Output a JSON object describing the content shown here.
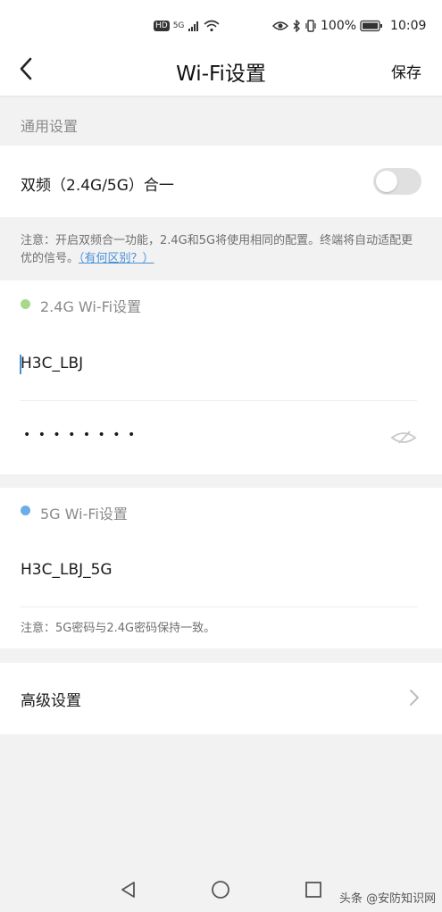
{
  "status_bar": {
    "hd": "HD",
    "net": "5G",
    "battery": "100%",
    "time": "10:09"
  },
  "header": {
    "title": "Wi-Fi设置",
    "save_label": "保存"
  },
  "general": {
    "section_label": "通用设置",
    "dual_band_label": "双频（2.4G/5G）合一",
    "dual_band_enabled": false,
    "note_prefix": "注意：开启双频合一功能，2.4G和5G将使用相同的配置。终端将自动适配更优的信号。",
    "note_link": "（有何区别？）"
  },
  "wifi_24": {
    "section_label": "2.4G Wi-Fi设置",
    "dot_color": "#a8d98a",
    "ssid": "H3C_LBJ",
    "password_mask": "• • • • • • • •"
  },
  "wifi_5": {
    "section_label": "5G Wi-Fi设置",
    "dot_color": "#6aaee8",
    "ssid": "H3C_LBJ_5G",
    "note": "注意：5G密码与2.4G密码保持一致。"
  },
  "advanced": {
    "label": "高级设置"
  },
  "watermark": "头条 @安防知识网"
}
